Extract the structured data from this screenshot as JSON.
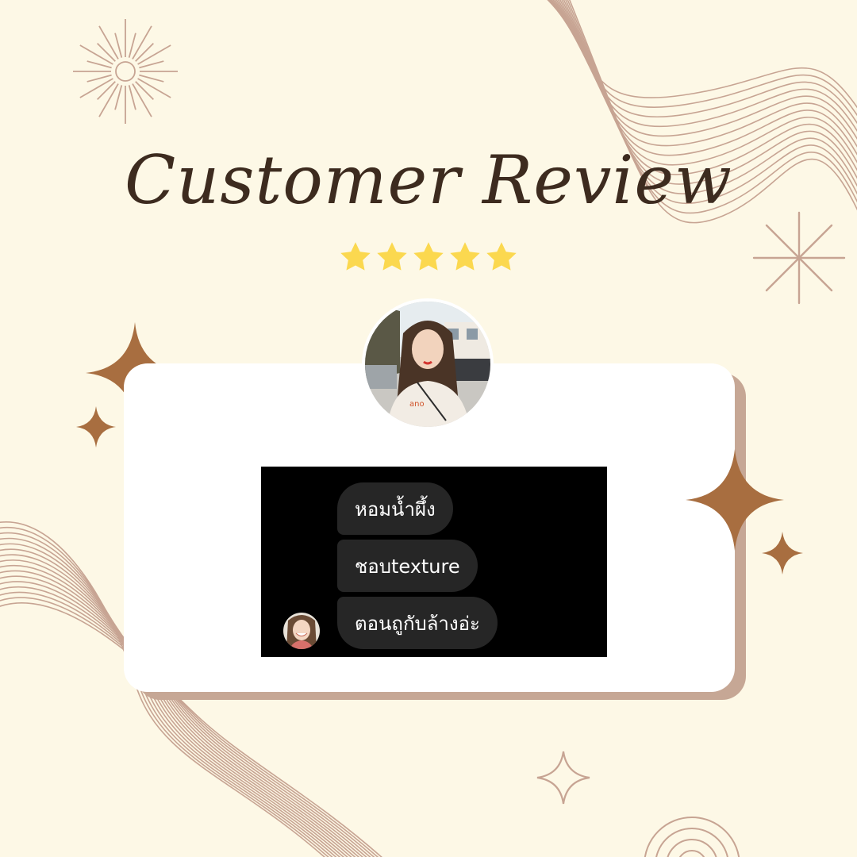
{
  "title": "Customer Review",
  "rating": {
    "value": 5,
    "max": 5
  },
  "messages": [
    {
      "text": "หอมน้ำผึ้ง"
    },
    {
      "text": "ชอบtexture"
    },
    {
      "text": "ตอนถูกับล้างอ่ะ"
    }
  ],
  "colors": {
    "background": "#fdf8e6",
    "title": "#3d2b1f",
    "star": "#fbd84f",
    "sparkle": "#a86e40",
    "line": "#c7a493",
    "card": "#ffffff",
    "card_shadow": "#c6a795",
    "chat_background": "#000000",
    "bubble": "#262626"
  },
  "icons": {
    "sunburst": "sunburst-icon",
    "asterisk": "asterisk-icon",
    "sparkle": "sparkle-icon",
    "star": "star-icon"
  }
}
